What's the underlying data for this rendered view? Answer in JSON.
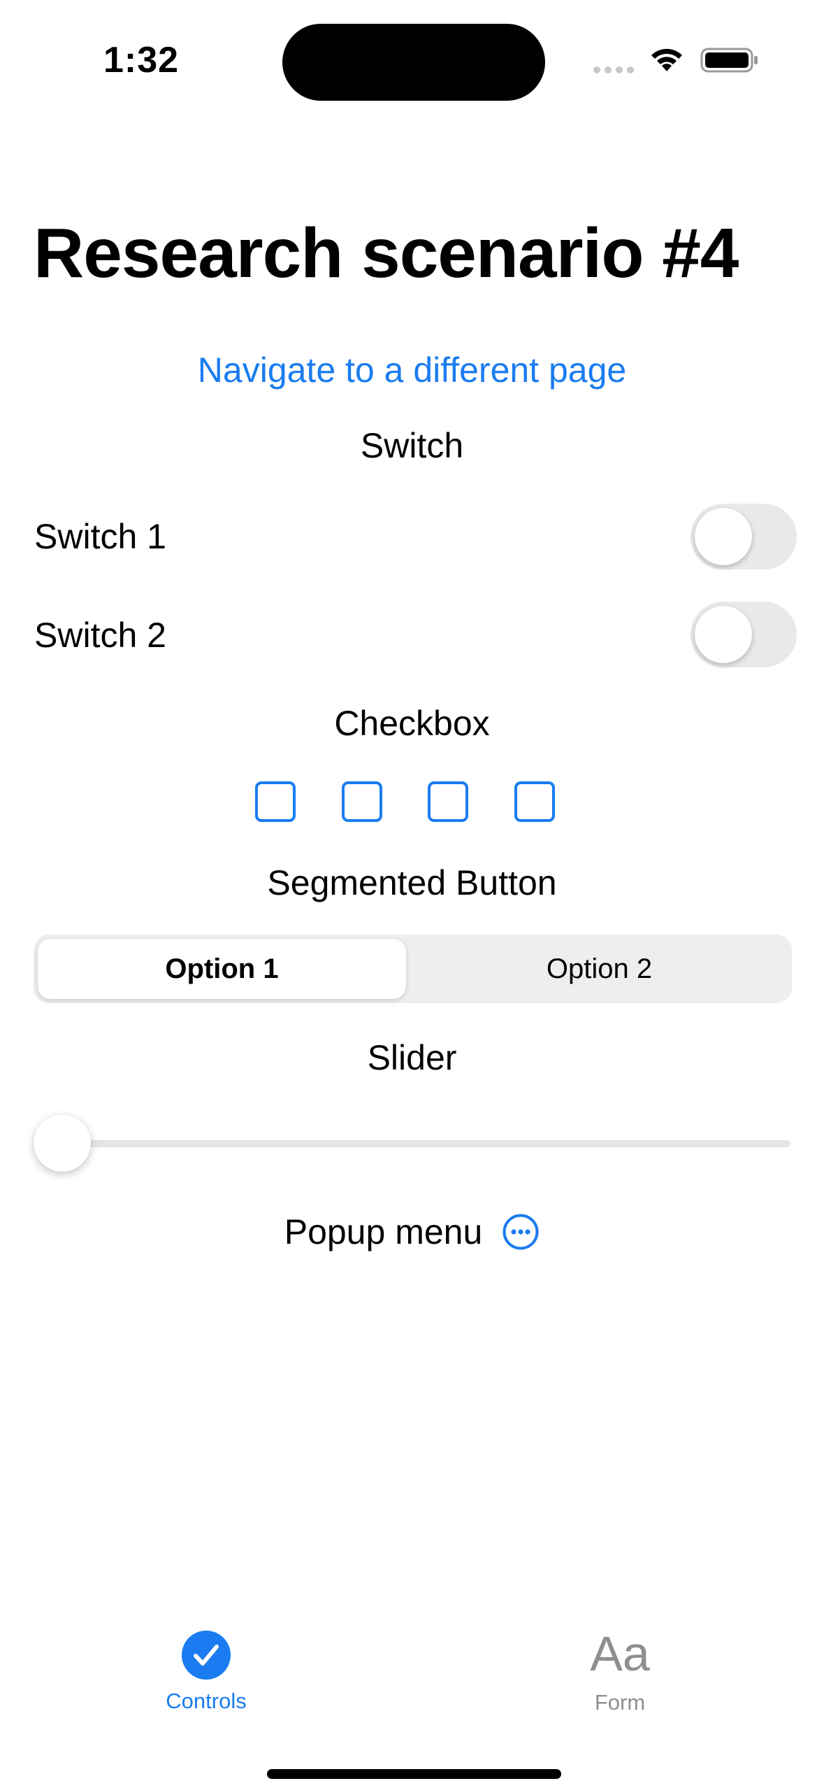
{
  "status_bar": {
    "time": "1:32"
  },
  "page": {
    "title": "Research scenario #4",
    "nav_link": "Navigate to a different page"
  },
  "switch_section": {
    "title": "Switch",
    "switches": [
      {
        "label": "Switch 1",
        "on": false
      },
      {
        "label": "Switch 2",
        "on": false
      }
    ]
  },
  "checkbox_section": {
    "title": "Checkbox",
    "checkboxes": [
      false,
      false,
      false,
      false
    ]
  },
  "segmented_section": {
    "title": "Segmented Button",
    "options": [
      "Option 1",
      "Option 2"
    ],
    "selected": "Option 1"
  },
  "slider_section": {
    "title": "Slider",
    "value": 0
  },
  "popup_section": {
    "label": "Popup menu",
    "icon": "ellipsis-circle-icon"
  },
  "tab_bar": {
    "tabs": [
      {
        "label": "Controls",
        "icon": "checkmark-circle-icon",
        "selected": true
      },
      {
        "label": "Form",
        "icon": "text-format-icon",
        "icon_text": "Aa",
        "selected": false
      }
    ]
  },
  "colors": {
    "accent": "#1a7cf0",
    "toggle_off": "#e9e9eb",
    "inactive_tab": "#8e8e93"
  }
}
